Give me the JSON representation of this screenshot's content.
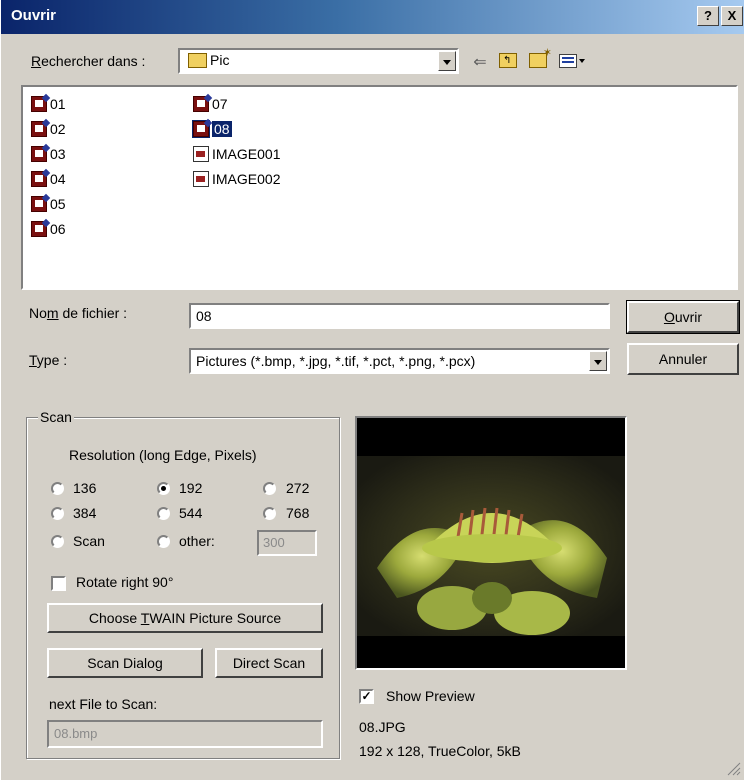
{
  "window": {
    "title": "Ouvrir",
    "help_btn": "?",
    "close_btn": "X"
  },
  "lookin": {
    "label_prefix": "R",
    "label_rest": "echercher dans :",
    "value": "Pic"
  },
  "files": [
    {
      "name": "01",
      "type": "img"
    },
    {
      "name": "02",
      "type": "img"
    },
    {
      "name": "03",
      "type": "img"
    },
    {
      "name": "04",
      "type": "img"
    },
    {
      "name": "05",
      "type": "img"
    },
    {
      "name": "06",
      "type": "img"
    },
    {
      "name": "07",
      "type": "img"
    },
    {
      "name": "08",
      "type": "img",
      "selected": true
    },
    {
      "name": "IMAGE001",
      "type": "doc"
    },
    {
      "name": "IMAGE002",
      "type": "doc"
    }
  ],
  "filename": {
    "label_a": "No",
    "label_u": "m",
    "label_b": " de fichier :",
    "value": "08"
  },
  "filetype": {
    "label_u": "T",
    "label_b": "ype :",
    "value": "Pictures (*.bmp, *.jpg, *.tif, *.pct, *.png, *.pcx)"
  },
  "buttons": {
    "open_u": "O",
    "open_rest": "uvrir",
    "cancel": "Annuler"
  },
  "scan": {
    "group_label": "Scan",
    "resolution_label": "Resolution (long Edge, Pixels)",
    "options": [
      "136",
      "192",
      "272",
      "384",
      "544",
      "768",
      "Scan",
      "other:"
    ],
    "selected": "192",
    "other_value": "300",
    "rotate_label": "Rotate right 90°",
    "choose_twain_a": "Choose ",
    "choose_twain_u": "T",
    "choose_twain_b": "WAIN Picture Source",
    "scan_dialog": "Scan Dialog",
    "direct_scan": "Direct Scan",
    "next_file_label": "next File to Scan:",
    "next_file_value": "08.bmp"
  },
  "preview": {
    "show_label": "Show Preview",
    "checked_mark": "✓",
    "file_name": "08.JPG",
    "file_info": "192 x 128, TrueColor, 5kB"
  }
}
